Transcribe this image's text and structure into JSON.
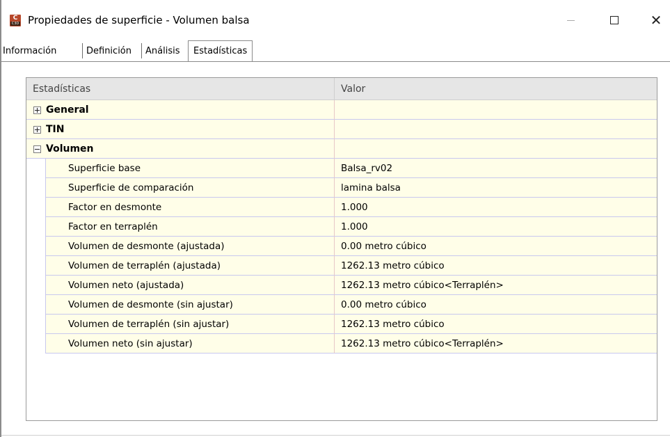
{
  "window": {
    "title": "Propiedades de superficie - Volumen balsa",
    "icon": "civil3d-app-icon",
    "icon_letter": "C",
    "icon_band": "C3D"
  },
  "tabs": [
    {
      "label": "Información",
      "active": false
    },
    {
      "label": "Definición",
      "active": false
    },
    {
      "label": "Análisis",
      "active": false
    },
    {
      "label": "Estadísticas",
      "active": true
    }
  ],
  "grid": {
    "col1_header": "Estadísticas",
    "col2_header": "Valor",
    "groups": [
      {
        "label": "General",
        "expanded": false,
        "value": ""
      },
      {
        "label": "TIN",
        "expanded": false,
        "value": ""
      },
      {
        "label": "Volumen",
        "expanded": true,
        "value": ""
      }
    ],
    "rows": [
      {
        "name": "Superficie base",
        "value": "Balsa_rv02"
      },
      {
        "name": "Superficie de comparación",
        "value": "lamina balsa"
      },
      {
        "name": "Factor en desmonte",
        "value": "1.000"
      },
      {
        "name": "Factor en terraplén",
        "value": "1.000"
      },
      {
        "name": "Volumen de desmonte (ajustada)",
        "value": "0.00 metro cúbico"
      },
      {
        "name": "Volumen de terraplén (ajustada)",
        "value": "1262.13 metro cúbico"
      },
      {
        "name": "Volumen neto (ajustada)",
        "value": "1262.13 metro cúbico<Terraplén>"
      },
      {
        "name": "Volumen de desmonte (sin ajustar)",
        "value": "0.00 metro cúbico"
      },
      {
        "name": "Volumen de terraplén (sin ajustar)",
        "value": "1262.13 metro cúbico"
      },
      {
        "name": "Volumen neto (sin ajustar)",
        "value": "1262.13 metro cúbico<Terraplén>"
      }
    ]
  },
  "colors": {
    "row_background": "#fffee8",
    "header_background": "#e6e6e6",
    "row_divider": "#c8c8ee",
    "column_divider": "#e8c7c7"
  }
}
